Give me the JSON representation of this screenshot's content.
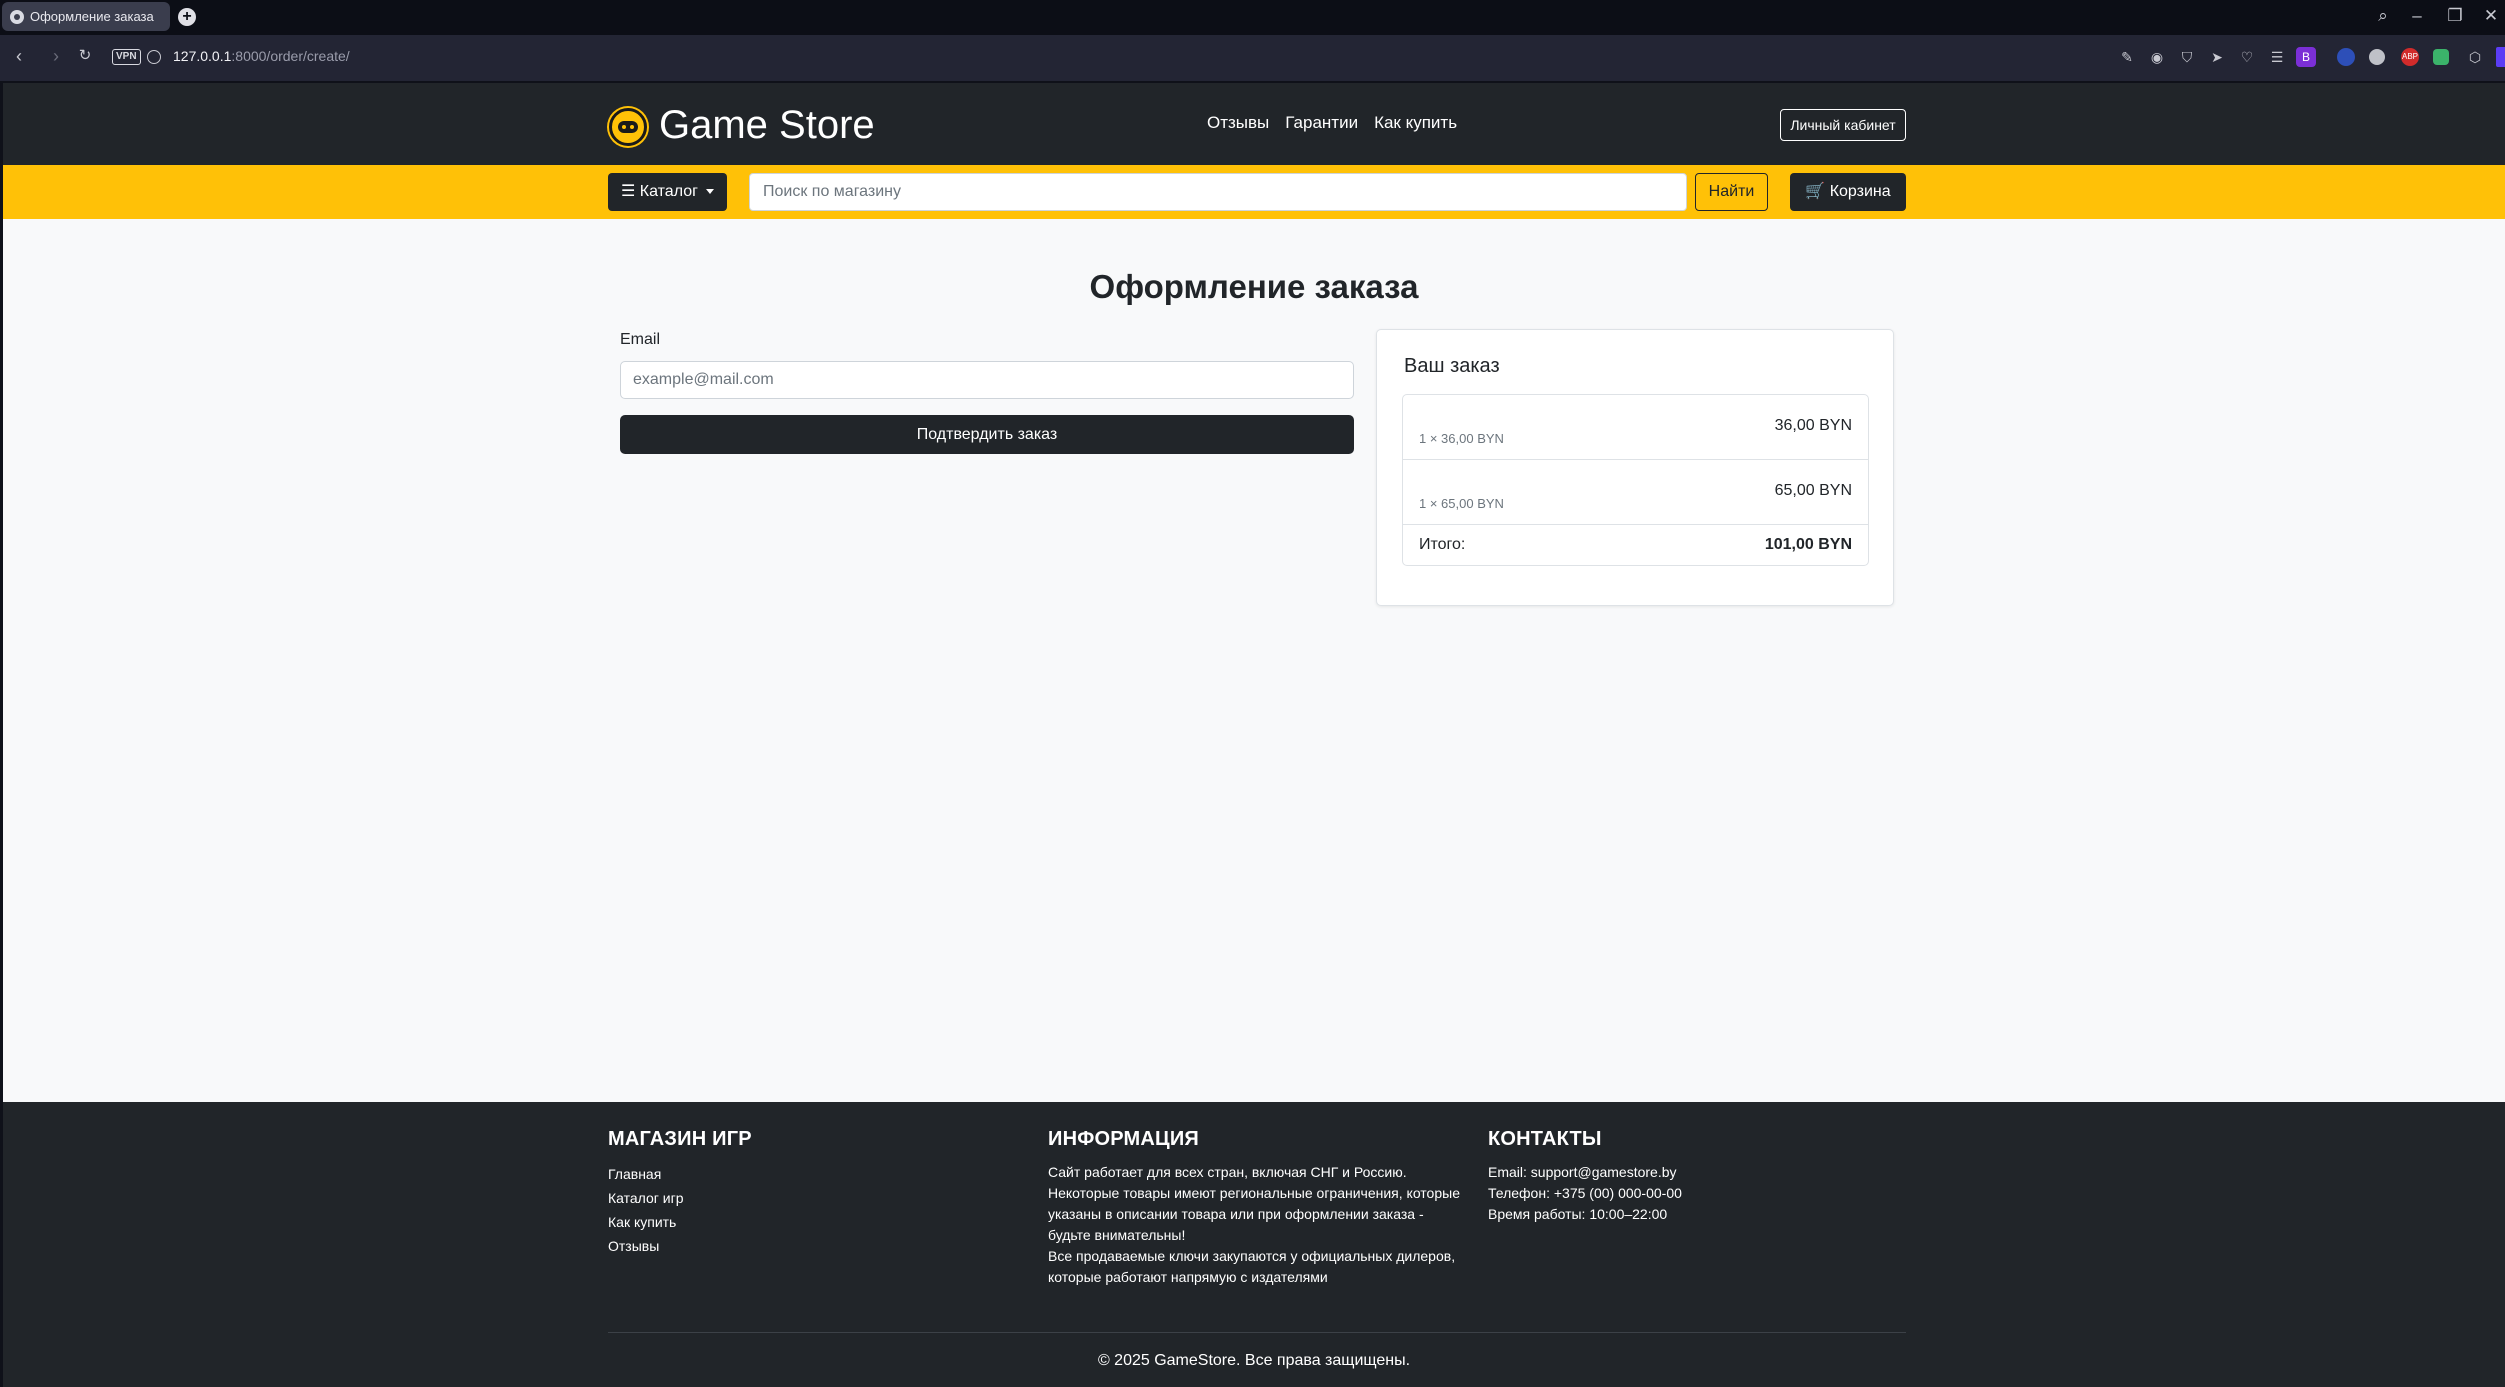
{
  "browser": {
    "tab_title": "Оформление заказа",
    "url_host": "127.0.0.1",
    "url_rest": ":8000/order/create/",
    "vpn_label": "VPN",
    "extension_label_b": "B",
    "extension_label_abp": "ABP"
  },
  "header": {
    "brand": "Game Store",
    "nav": [
      "Отзывы",
      "Гарантии",
      "Как купить"
    ],
    "account_button": "Личный кабинет"
  },
  "toolbar": {
    "catalog_label": "☰ Каталог",
    "search_placeholder": "Поиск по магазину",
    "search_button": "Найти",
    "cart_label": "🛒 Корзина"
  },
  "checkout": {
    "title": "Оформление заказа",
    "email_label": "Email",
    "email_placeholder": "example@mail.com",
    "email_value": "",
    "confirm_button": "Подтвердить заказ"
  },
  "order_summary": {
    "title": "Ваш заказ",
    "items": [
      {
        "quantity_line": "1 × 36,00 BYN",
        "price": "36,00 BYN"
      },
      {
        "quantity_line": "1 × 65,00 BYN",
        "price": "65,00 BYN"
      }
    ],
    "total_label": "Итого:",
    "total_value": "101,00 BYN"
  },
  "footer": {
    "store": {
      "heading": "МАГАЗИН ИГР",
      "links": [
        "Главная",
        "Каталог игр",
        "Как купить",
        "Отзывы"
      ]
    },
    "info": {
      "heading": "ИНФОРМАЦИЯ",
      "lines": [
        "Сайт работает для всех стран, включая СНГ и Россию.",
        "Некоторые товары имеют региональные ограничения, которые",
        "указаны в описании товара или при оформлении заказа -",
        "будьте внимательны!",
        "Все продаваемые ключи закупаются у официальных дилеров,",
        "которые работают напрямую с издателями"
      ]
    },
    "contacts": {
      "heading": "КОНТАКТЫ",
      "lines": [
        "Email: support@gamestore.by",
        "Телефон: +375 (00) 000-00-00",
        "Время работы: 10:00–22:00"
      ]
    },
    "copyright": "© 2025 GameStore. Все права защищены."
  },
  "colors": {
    "accent_yellow": "#ffc107",
    "dark": "#212529",
    "page_bg": "#f8f9fa"
  }
}
